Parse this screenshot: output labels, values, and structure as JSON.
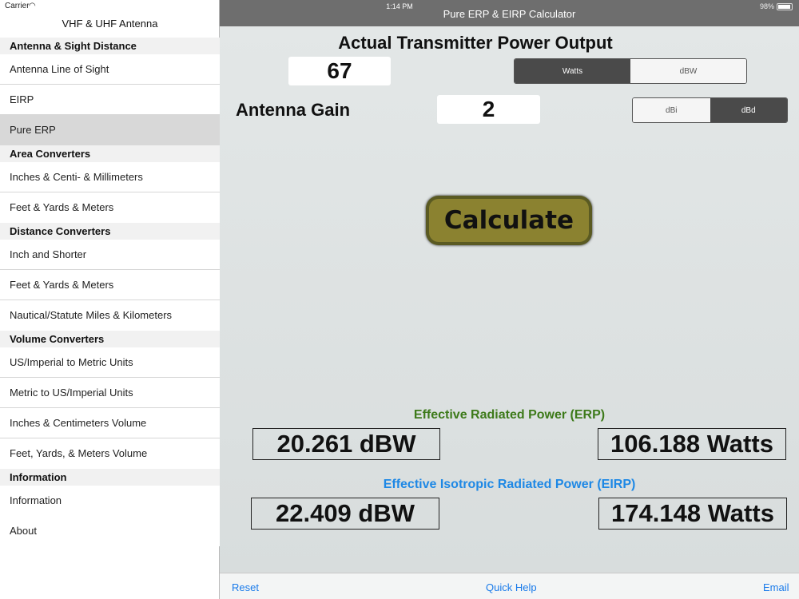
{
  "status": {
    "carrier": "Carrier",
    "time": "1:14 PM",
    "battery": "98%"
  },
  "sidebar": {
    "title": "VHF & UHF Antenna",
    "sections": [
      {
        "header": "Antenna & Sight Distance",
        "items": [
          "Antenna Line of Sight",
          "EIRP",
          "Pure ERP"
        ]
      },
      {
        "header": "Area Converters",
        "items": [
          "Inches & Centi- & Millimeters",
          "Feet & Yards & Meters"
        ]
      },
      {
        "header": "Distance Converters",
        "items": [
          "Inch and Shorter",
          "Feet & Yards & Meters",
          "Nautical/Statute Miles & Kilometers"
        ]
      },
      {
        "header": "Volume Converters",
        "items": [
          "US/Imperial to Metric Units",
          "Metric to US/Imperial Units",
          "Inches & Centimeters Volume",
          "Feet, Yards, & Meters Volume"
        ]
      },
      {
        "header": "Information",
        "items": [
          "Information",
          "About"
        ]
      }
    ]
  },
  "nav": {
    "title": "Pure ERP & EIRP Calculator"
  },
  "form": {
    "power_heading": "Actual Transmitter Power Output",
    "power_value": "67",
    "power_units": [
      "Watts",
      "dBW"
    ],
    "power_units_selected": "Watts",
    "gain_label": "Antenna Gain",
    "gain_value": "2",
    "gain_units": [
      "dBi",
      "dBd"
    ],
    "gain_units_selected": "dBd",
    "calculate_label": "Calculate"
  },
  "results": {
    "erp_heading": "Effective Radiated Power (ERP)",
    "erp_dbw": "20.261 dBW",
    "erp_watts": "106.188 Watts",
    "eirp_heading": "Effective Isotropic Radiated Power (EIRP)",
    "eirp_dbw": "22.409 dBW",
    "eirp_watts": "174.148 Watts"
  },
  "toolbar": {
    "reset": "Reset",
    "quick_help": "Quick Help",
    "email": "Email"
  },
  "colors": {
    "erp_heading": "#3d7a1a",
    "eirp_heading": "#1e88e5",
    "link": "#1a7bea"
  }
}
